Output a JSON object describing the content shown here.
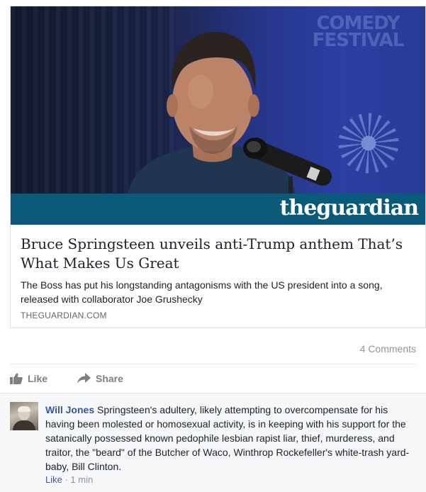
{
  "link_card": {
    "image_text": {
      "festival_line1": "COMEDY",
      "festival_line2": "FESTIVAL"
    },
    "brand": {
      "the": "the",
      "name": "guardian"
    },
    "title": "Bruce Springsteen unveils anti-Trump anthem That’s What Makes Us Great",
    "description": "The Boss has put his longstanding antagonisms with the US president into a song, released with collaborator Joe Grushecky",
    "domain": "THEGUARDIAN.COM"
  },
  "counts": {
    "comments": "4 Comments"
  },
  "actions": {
    "like_label": "Like",
    "share_label": "Share"
  },
  "comment": {
    "author": "Will Jones",
    "text": " Springsteen's adultery, likely attempting to overcompensate for his having been molested or homosexual activity, is in keeping with his support for the satanically possessed known pedophile lesbian rapist liar, thief, murderess, and traitor, the \"beard\" of the Butcher of Waco, Winthrop Rockefeller's white-trash yard-baby, Bill Clinton.",
    "like_label": "Like",
    "separator": " · ",
    "time": "1 min"
  },
  "icons": {
    "like": "thumbs-up-icon",
    "share": "share-arrow-icon"
  },
  "colors": {
    "link_blue": "#365899",
    "guardian_blue": "#0b5a7a",
    "meta_gray": "#90949c"
  }
}
